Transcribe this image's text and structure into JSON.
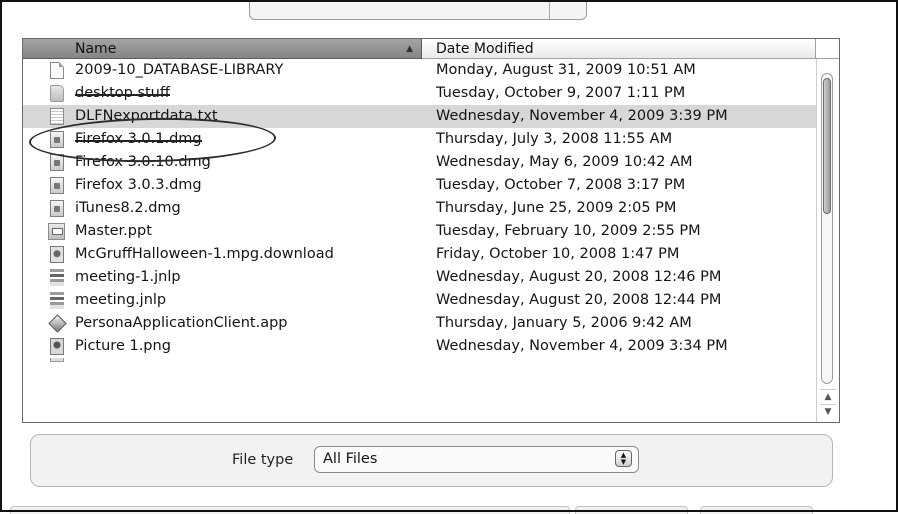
{
  "columns": {
    "name": "Name",
    "date": "Date Modified"
  },
  "files": [
    {
      "name": "2009-10_DATABASE-LIBRARY",
      "date": "Monday, August 31, 2009 10:51 AM",
      "icon": "document-icon"
    },
    {
      "name": "desktop stuff",
      "date": "Tuesday, October 9, 2007 1:11 PM",
      "icon": "folder-icon"
    },
    {
      "name": "DLFNexportdata.txt",
      "date": "Wednesday, November 4, 2009 3:39 PM",
      "icon": "text-file-icon",
      "selected": true
    },
    {
      "name": "Firefox 3.0.1.dmg",
      "date": "Thursday, July 3, 2008 11:55 AM",
      "icon": "disk-image-icon"
    },
    {
      "name": "Firefox 3.0.10.dmg",
      "date": "Wednesday, May 6, 2009 10:42 AM",
      "icon": "disk-image-icon"
    },
    {
      "name": "Firefox 3.0.3.dmg",
      "date": "Tuesday, October 7, 2008 3:17 PM",
      "icon": "disk-image-icon"
    },
    {
      "name": "iTunes8.2.dmg",
      "date": "Thursday, June 25, 2009 2:05 PM",
      "icon": "disk-image-icon"
    },
    {
      "name": "Master.ppt",
      "date": "Tuesday, February 10, 2009 2:55 PM",
      "icon": "presentation-icon"
    },
    {
      "name": "McGruffHalloween-1.mpg.download",
      "date": "Friday, October 10, 2008 1:47 PM",
      "icon": "movie-download-icon"
    },
    {
      "name": "meeting-1.jnlp",
      "date": "Wednesday, August 20, 2008 12:46 PM",
      "icon": "java-launch-icon"
    },
    {
      "name": "meeting.jnlp",
      "date": "Wednesday, August 20, 2008 12:44 PM",
      "icon": "java-launch-icon"
    },
    {
      "name": "PersonaApplicationClient.app",
      "date": "Thursday, January 5, 2006 9:42 AM",
      "icon": "application-icon"
    },
    {
      "name": "Picture 1.png",
      "date": "Wednesday, November 4, 2009 3:34 PM",
      "icon": "image-icon"
    }
  ],
  "file_type": {
    "label": "File type",
    "selected": "All Files"
  }
}
